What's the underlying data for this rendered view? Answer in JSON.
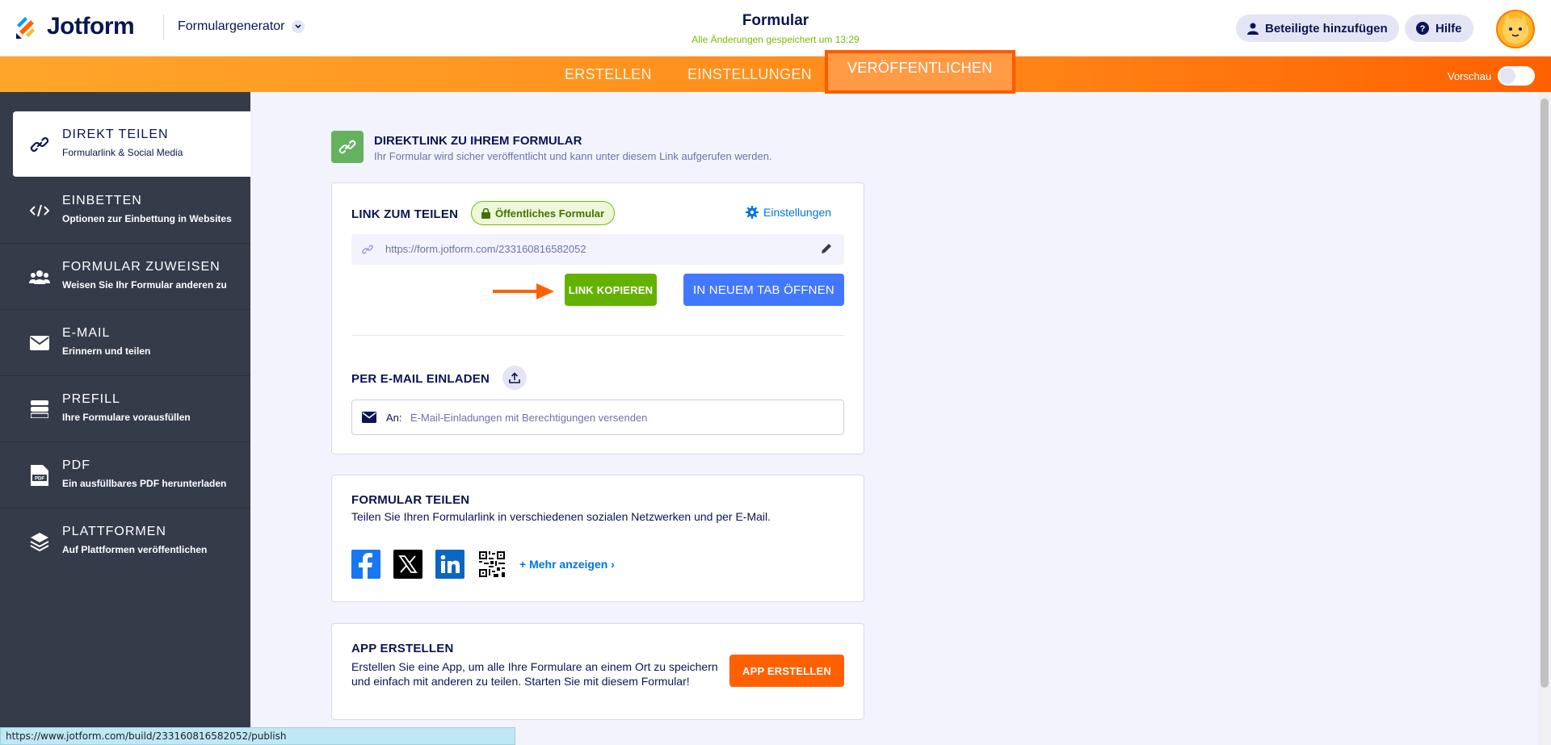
{
  "header": {
    "brand": "Jotform",
    "builder_select": "Formulargenerator",
    "form_title": "Formular",
    "save_status": "Alle Änderungen gespeichert um 13:29",
    "add_participants": "Beteiligte hinzufügen",
    "help": "Hilfe"
  },
  "nav": {
    "tabs": [
      {
        "label": "ERSTELLEN"
      },
      {
        "label": "EINSTELLUNGEN"
      },
      {
        "label": "VERÖFFENTLICHEN"
      }
    ],
    "active_tab": "VERÖFFENTLICHEN",
    "preview_label": "Vorschau",
    "preview_on": false
  },
  "sidebar": {
    "items": [
      {
        "title": "DIREKT TEILEN",
        "sub": "Formularlink & Social Media",
        "icon": "link-icon",
        "active": true
      },
      {
        "title": "EINBETTEN",
        "sub": "Optionen zur Einbettung in Websites",
        "icon": "code-icon"
      },
      {
        "title": "FORMULAR ZUWEISEN",
        "sub": "Weisen Sie Ihr Formular anderen zu",
        "icon": "users-icon"
      },
      {
        "title": "E-MAIL",
        "sub": "Erinnern und teilen",
        "icon": "mail-icon"
      },
      {
        "title": "PREFILL",
        "sub": "Ihre Formulare vorausfüllen",
        "icon": "prefill-icon"
      },
      {
        "title": "PDF",
        "sub": "Ein ausfüllbares PDF herunterladen",
        "icon": "pdf-icon"
      },
      {
        "title": "PLATTFORMEN",
        "sub": "Auf Plattformen veröffentlichen",
        "icon": "layers-icon"
      }
    ]
  },
  "direct_link": {
    "title": "DIREKTLINK ZU IHREM FORMULAR",
    "subtitle": "Ihr Formular wird sicher veröffentlicht und kann unter diesem Link aufgerufen werden."
  },
  "share_card": {
    "label": "LINK ZUM TEILEN",
    "public_badge": "Öffentliches Formular",
    "settings": "Einstellungen",
    "url": "https://form.jotform.com/233160816582052",
    "copy_button": "LINK KOPIEREN",
    "open_button": "IN NEUEM TAB ÖFFNEN",
    "invite_label": "PER E-MAIL EINLADEN",
    "email_to": "An:",
    "email_placeholder": "E-Mail-Einladungen mit Berechtigungen versenden"
  },
  "social_card": {
    "title": "FORMULAR TEILEN",
    "subtitle": "Teilen Sie Ihren Formularlink in verschiedenen sozialen Netzwerken und per E-Mail.",
    "networks": [
      "facebook-icon",
      "x-icon",
      "linkedin-icon",
      "qr-code-icon"
    ],
    "more": "+ Mehr anzeigen ›"
  },
  "app_card": {
    "title": "APP ERSTELLEN",
    "text": "Erstellen Sie eine App, um alle Ihre Formulare an einem Ort zu speichern und einfach mit anderen zu teilen. Starten Sie mit diesem Formular!",
    "button": "APP ERSTELLEN"
  },
  "status_bar": {
    "url": "https://www.jotform.com/build/233160816582052/publish"
  },
  "colors": {
    "navy": "#0a1551",
    "orange": "#ff6100",
    "green": "#64b200",
    "blue": "#4277ff",
    "sidebar": "#343c4a"
  }
}
